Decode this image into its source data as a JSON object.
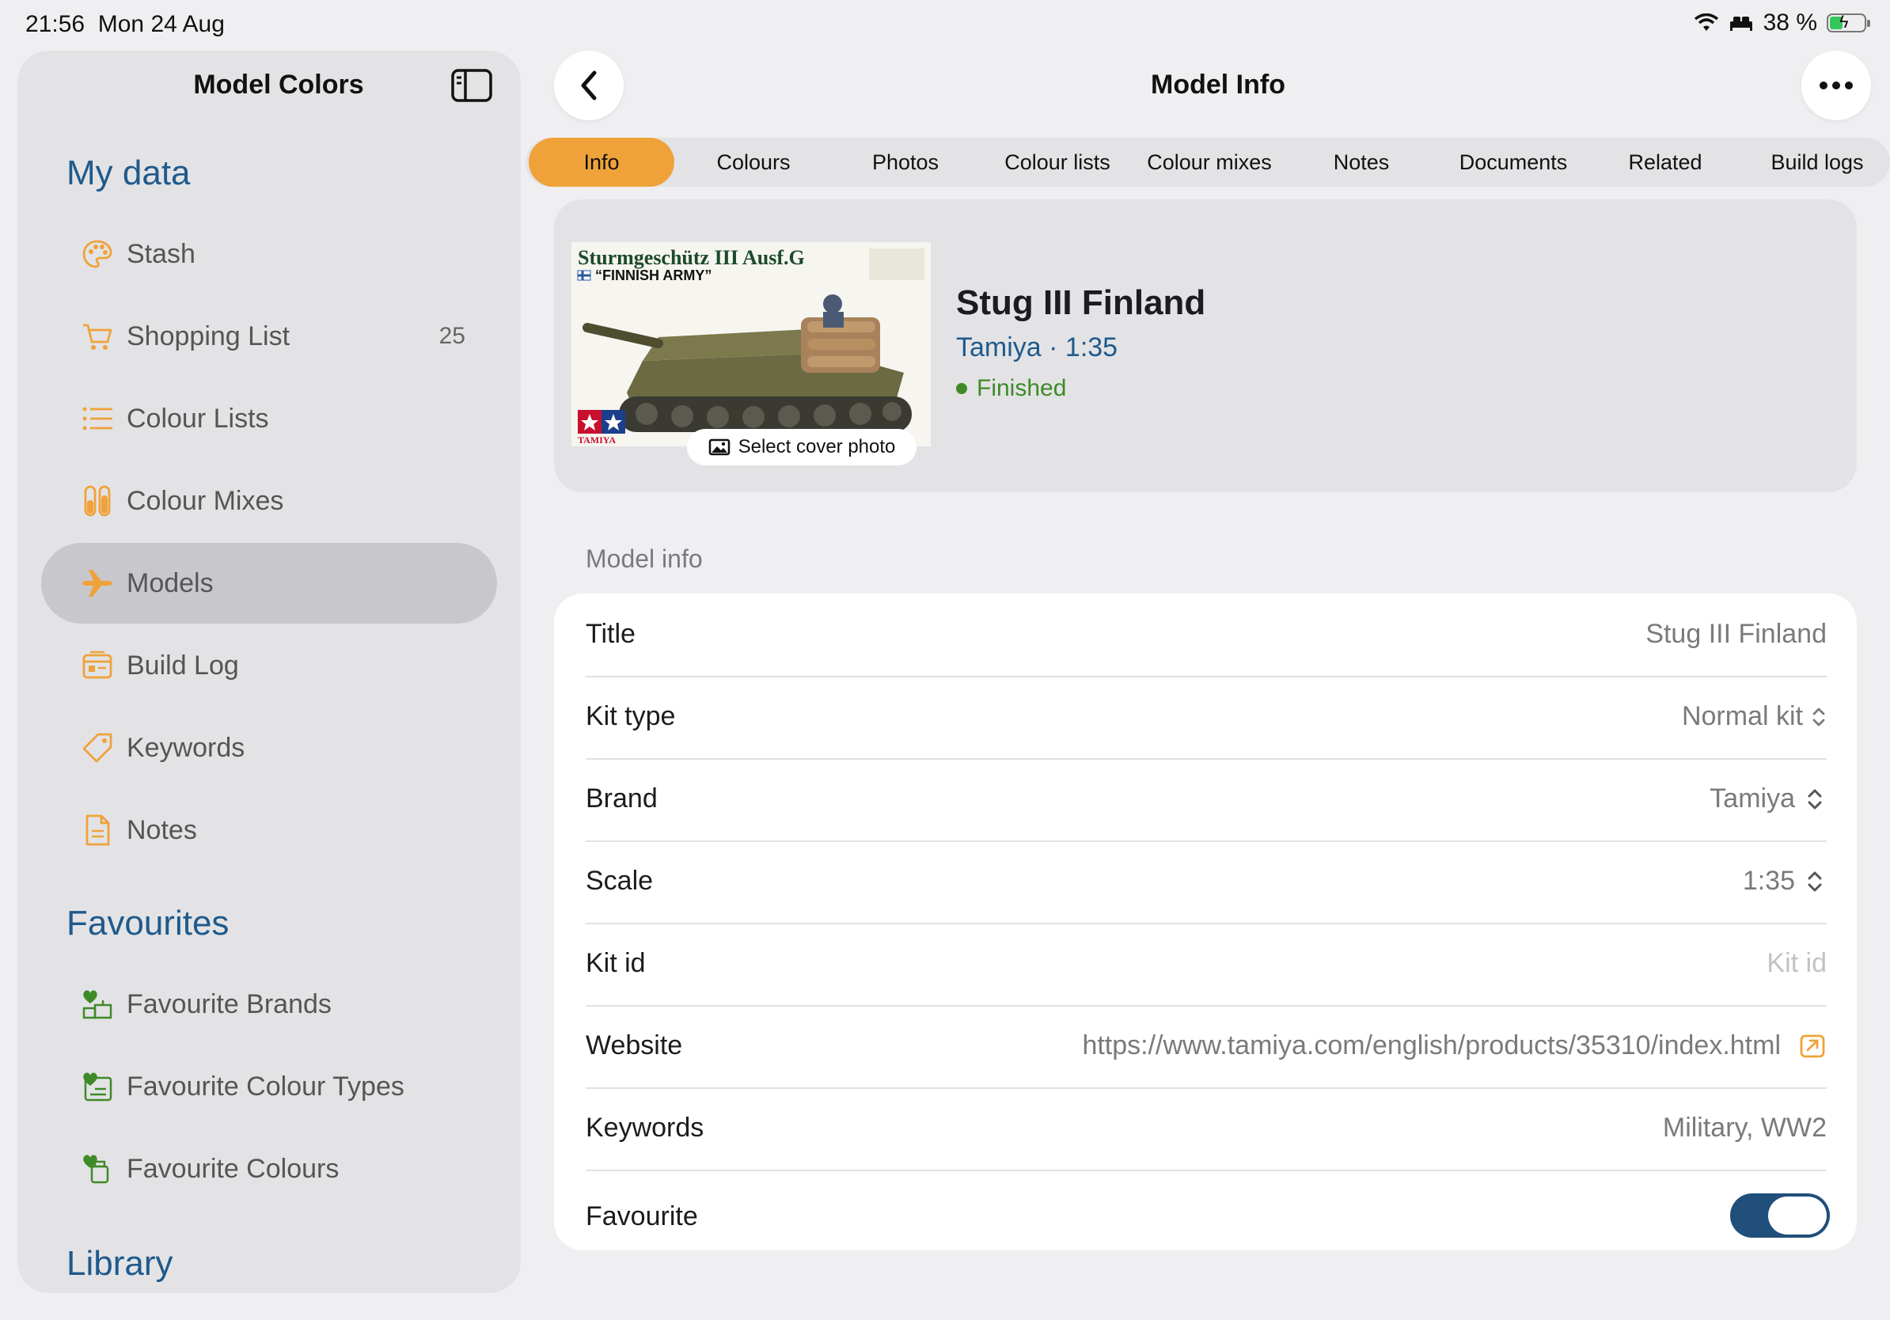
{
  "status_bar": {
    "time": "21:56",
    "date": "Mon 24 Aug",
    "battery_percent": "38 %",
    "battery_level": 0.38
  },
  "sidebar": {
    "title": "Model Colors",
    "sections": {
      "my_data": "My data",
      "favourites": "Favourites",
      "library": "Library"
    },
    "my_data_items": [
      {
        "label": "Stash",
        "icon": "palette-icon",
        "badge": ""
      },
      {
        "label": "Shopping List",
        "icon": "cart-icon",
        "badge": "25"
      },
      {
        "label": "Colour Lists",
        "icon": "list-icon",
        "badge": ""
      },
      {
        "label": "Colour Mixes",
        "icon": "test-tubes-icon",
        "badge": ""
      },
      {
        "label": "Models",
        "icon": "airplane-icon",
        "badge": "",
        "active": true
      },
      {
        "label": "Build Log",
        "icon": "log-book-icon",
        "badge": ""
      },
      {
        "label": "Keywords",
        "icon": "tag-icon",
        "badge": ""
      },
      {
        "label": "Notes",
        "icon": "document-icon",
        "badge": ""
      }
    ],
    "favourite_items": [
      {
        "label": "Favourite Brands",
        "icon": "heart-brands-icon"
      },
      {
        "label": "Favourite Colour Types",
        "icon": "heart-colour-types-icon"
      },
      {
        "label": "Favourite Colours",
        "icon": "heart-colours-icon"
      }
    ]
  },
  "main": {
    "title": "Model Info",
    "tabs": [
      {
        "label": "Info",
        "active": true
      },
      {
        "label": "Colours"
      },
      {
        "label": "Photos"
      },
      {
        "label": "Colour lists"
      },
      {
        "label": "Colour mixes"
      },
      {
        "label": "Notes"
      },
      {
        "label": "Documents"
      },
      {
        "label": "Related"
      },
      {
        "label": "Build logs"
      }
    ],
    "cover": {
      "box_title": "Sturmgeschütz III Ausf.G",
      "box_subtitle": "“FINNISH ARMY”",
      "box_brand": "TAMIYA",
      "select_label": "Select cover photo",
      "model_name": "Stug III Finland",
      "brand_scale": "Tamiya · 1:35",
      "status": "Finished"
    },
    "group_header": "Model info",
    "rows": [
      {
        "label": "Title",
        "value": "Stug III Finland"
      },
      {
        "label": "Kit type",
        "value": "Normal kit"
      },
      {
        "label": "Brand",
        "value": "Tamiya"
      },
      {
        "label": "Scale",
        "value": "1:35"
      },
      {
        "label": "Kit id",
        "placeholder": "Kit id"
      },
      {
        "label": "Website",
        "value": "https://www.tamiya.com/english/products/35310/index.html"
      },
      {
        "label": "Keywords",
        "value": "Military, WW2"
      },
      {
        "label": "Favourite",
        "value_on": true
      }
    ]
  },
  "colors": {
    "accent": "#f0a23a",
    "link_blue": "#1f5a8c",
    "status_green": "#3f8a28",
    "toggle_on": "#1f4f7a"
  }
}
